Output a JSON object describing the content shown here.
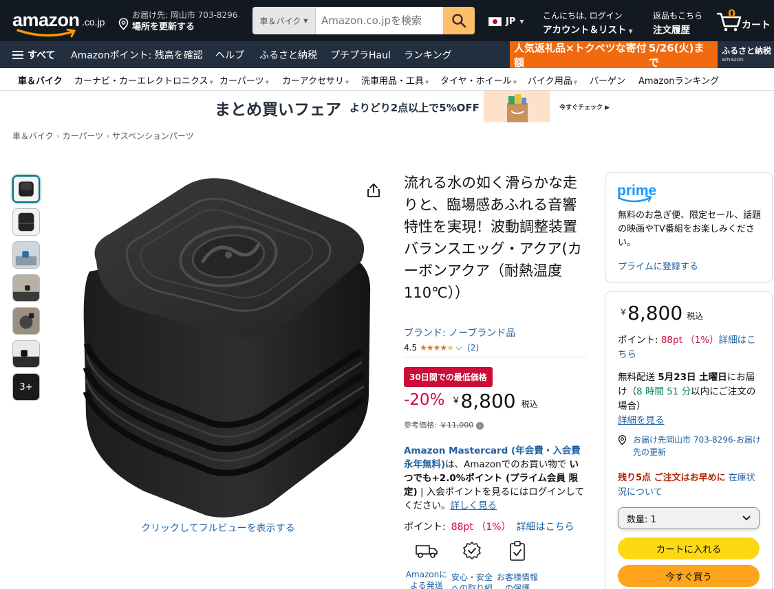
{
  "header": {
    "logo_text": "amazon",
    "logo_tld": ".co.jp",
    "deliver_to": "お届け先: 岡山市 703-8296",
    "update_location": "場所を更新する",
    "search_category": "車＆バイク",
    "search_placeholder": "Amazon.co.jpを検索",
    "language": "JP",
    "account_greeting": "こんにちは, ログイン",
    "account_lists": "アカウント＆リスト",
    "returns": "返品もこちら",
    "orders": "注文履歴",
    "cart_count": "0",
    "cart_label": "カート"
  },
  "main_nav": {
    "all": "すべて",
    "items": [
      "Amazonポイント: 残高を確認",
      "ヘルプ",
      "ふるさと納税",
      "プチプラHaul",
      "ランキング"
    ],
    "promo_text": "人気返礼品×トクベツな寄付額",
    "promo_date": "5/26(火)まで",
    "furusato_label": "ふるさと納税",
    "furusato_sub": "amazon"
  },
  "sub_nav": {
    "items": [
      {
        "label": "車＆バイク"
      },
      {
        "label": "カーナビ・カーエレクトロニクス"
      },
      {
        "label": "カーパーツ"
      },
      {
        "label": "カーアクセサリ"
      },
      {
        "label": "洗車用品・工具"
      },
      {
        "label": "タイヤ・ホイール"
      },
      {
        "label": "バイク用品"
      },
      {
        "label": "バーゲン"
      },
      {
        "label": "Amazonランキング"
      }
    ]
  },
  "banner": {
    "title": "まとめ買いフェア",
    "subtitle": "よりどり2点以上で5%OFF",
    "cta": "今すぐチェック ▶"
  },
  "breadcrumb": [
    "車＆バイク",
    "カーパーツ",
    "サスペンションパーツ"
  ],
  "gallery": {
    "more_label": "3+",
    "fullview": "クリックしてフルビューを表示する"
  },
  "product": {
    "title": "流れる水の如く滑らかな走りと、臨場感あふれる音響特性を実現！波動調整装置 バランスエッグ・アクア(カーボンアクア（耐熱温度110℃））",
    "brand": "ブランド: ノーブランド品",
    "rating": "4.5",
    "rating_count": "(2)",
    "deal_badge": "30日間での最低価格",
    "discount": "-20%",
    "currency": "￥",
    "price": "8,800",
    "tax_label": "税込",
    "list_price_label": "参考価格:",
    "list_price": "￥11,000",
    "mc_name": "Amazon Mastercard (年会費・入会費永年無料)",
    "mc_text1": "は、Amazonでのお買い物で",
    "mc_bold": "いつでも+2.0%ポイント (プライム会員 限定)",
    "mc_text2": "| 入会ポイントを見るにはログインしてください。",
    "mc_link": "詳しく見る",
    "points_label": "ポイント:",
    "points_value": "88pt （1%）",
    "points_link": "詳細はこちら",
    "badges": [
      "Amazonによる発送",
      "安心・安全への取り組み",
      "お客様情報の保護"
    ]
  },
  "prime": {
    "logo": "prime",
    "description": "無料のお急ぎ便、限定セール、話題の映画やTV番組をお楽しみください。",
    "join": "プライムに登録する"
  },
  "buy_box": {
    "currency": "￥",
    "price": "8,800",
    "tax_label": "税込",
    "points_label": "ポイント: ",
    "points_value": "88pt （1%）",
    "points_link": "詳細はこちら",
    "ship_prefix": "無料配送 ",
    "ship_date": "5月23日 土曜日",
    "ship_suffix": "にお届け（",
    "ship_countdown": "8 時間 51 分",
    "ship_tail": "以内にご注文の場合）",
    "ship_link": "詳細を見る",
    "location": "お届け先岡山市 703-8296‐お届け先の更新",
    "stock_warning": "残り5点 ご注文はお早めに",
    "stock_link": "在庫状況について",
    "qty_label": "数量: 1",
    "add_to_cart": "カートに入れる",
    "buy_now": "今すぐ買う"
  },
  "colors": {
    "header_bg": "#131921",
    "nav_bg": "#232f3e",
    "promo_orange": "#f26a0f",
    "search_button": "#febd69",
    "link_blue": "#2162a1",
    "deal_red": "#cc0c39",
    "star_orange": "#de7921",
    "cart_yellow": "#ffd814",
    "buy_orange": "#ffa41c",
    "prime_blue": "#1399ff"
  }
}
